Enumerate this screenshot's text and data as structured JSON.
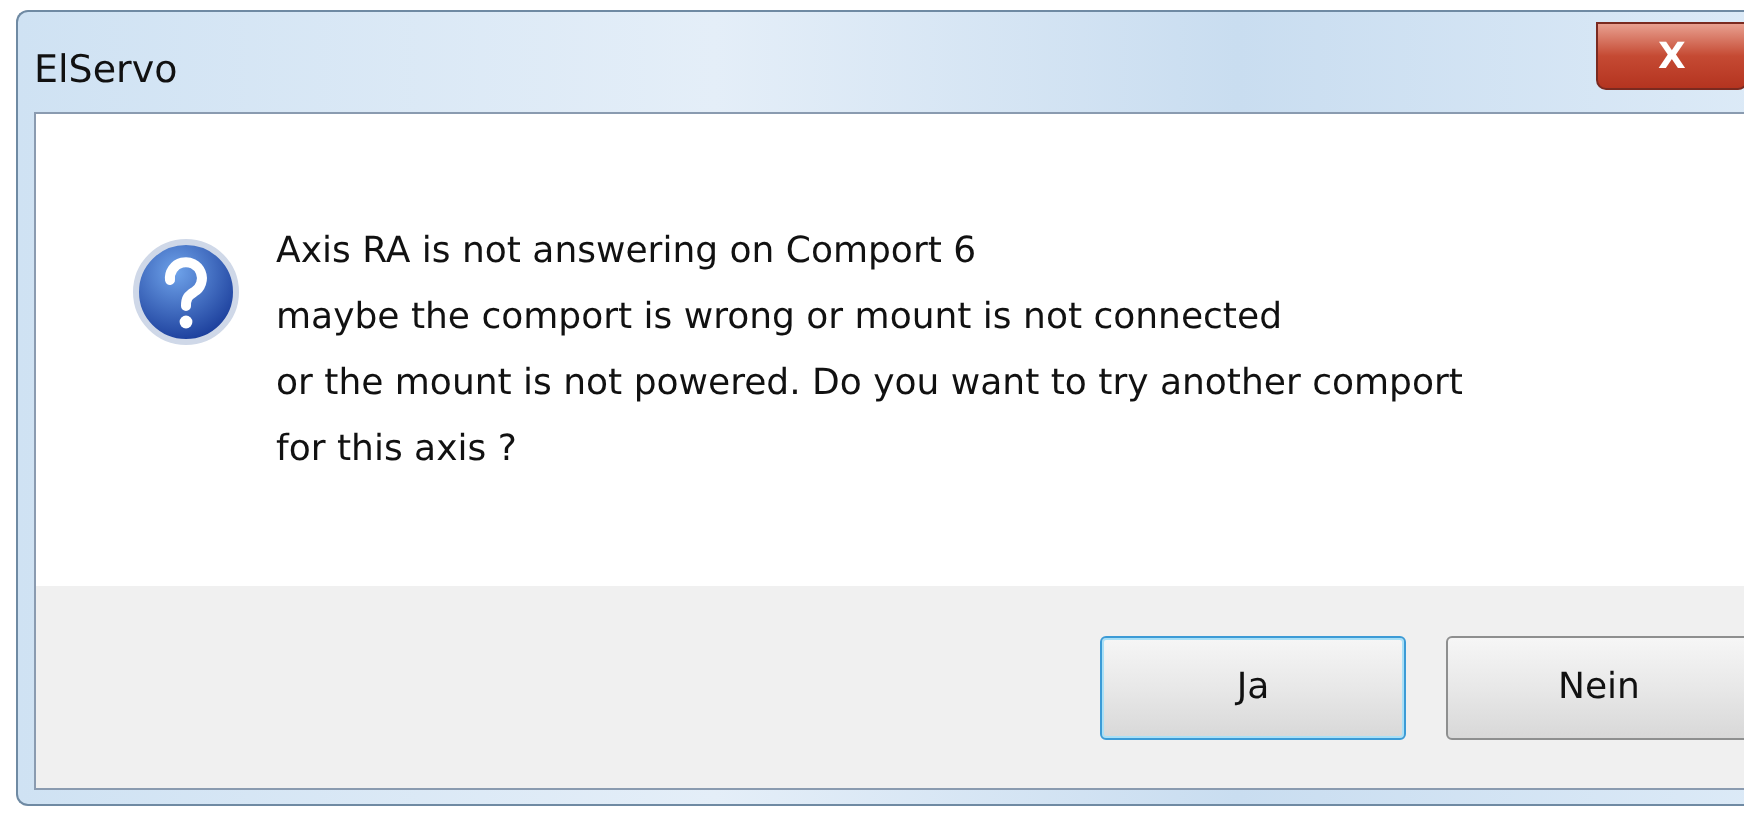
{
  "window": {
    "title": "ElServo",
    "close_label": "X"
  },
  "message": {
    "lines": [
      "Axis RA is not answering on Comport 6",
      "maybe the comport is wrong or mount is not connected",
      "or the mount is not powered. Do you want to try another comport",
      "for this axis ?"
    ]
  },
  "buttons": [
    {
      "label": "Ja",
      "focused": true
    },
    {
      "label": "Nein",
      "focused": false
    }
  ]
}
